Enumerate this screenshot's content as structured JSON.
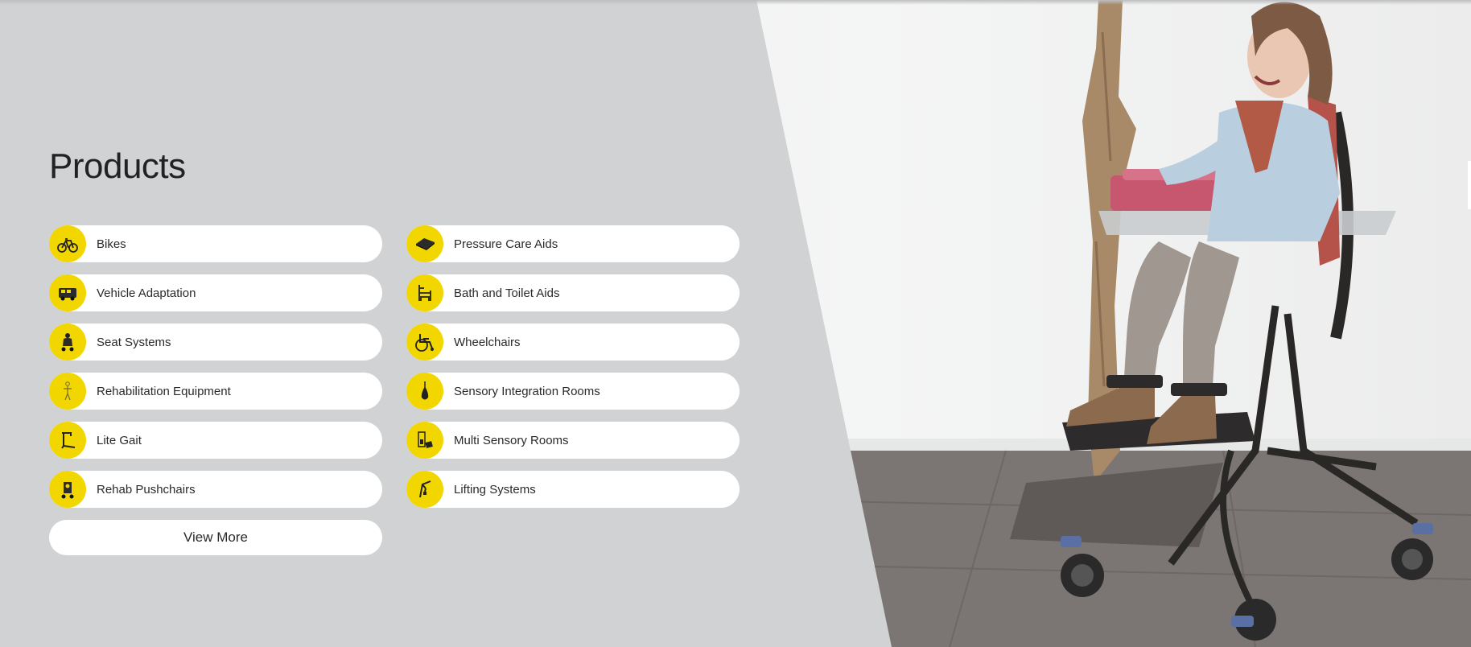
{
  "section": {
    "title": "Products",
    "view_more_label": "View More"
  },
  "products": [
    {
      "label": "Bikes",
      "icon": "bike-icon"
    },
    {
      "label": "Pressure Care Aids",
      "icon": "cushion-icon"
    },
    {
      "label": "Vehicle Adaptation",
      "icon": "van-icon"
    },
    {
      "label": "Bath and Toilet Aids",
      "icon": "bath-chair-icon"
    },
    {
      "label": "Seat Systems",
      "icon": "seat-icon"
    },
    {
      "label": "Wheelchairs",
      "icon": "wheelchair-icon"
    },
    {
      "label": "Rehabilitation Equipment",
      "icon": "body-figure-icon"
    },
    {
      "label": "Sensory Integration Rooms",
      "icon": "swing-icon"
    },
    {
      "label": "Lite Gait",
      "icon": "gait-trainer-icon"
    },
    {
      "label": "Multi Sensory Rooms",
      "icon": "sensory-panel-icon"
    },
    {
      "label": "Rehab Pushchairs",
      "icon": "pushchair-icon"
    },
    {
      "label": "Lifting Systems",
      "icon": "lift-icon"
    }
  ],
  "colors": {
    "background": "#d1d2d4",
    "icon_circle": "#f2d600",
    "pill": "#ffffff",
    "text": "#2a2a2a"
  }
}
